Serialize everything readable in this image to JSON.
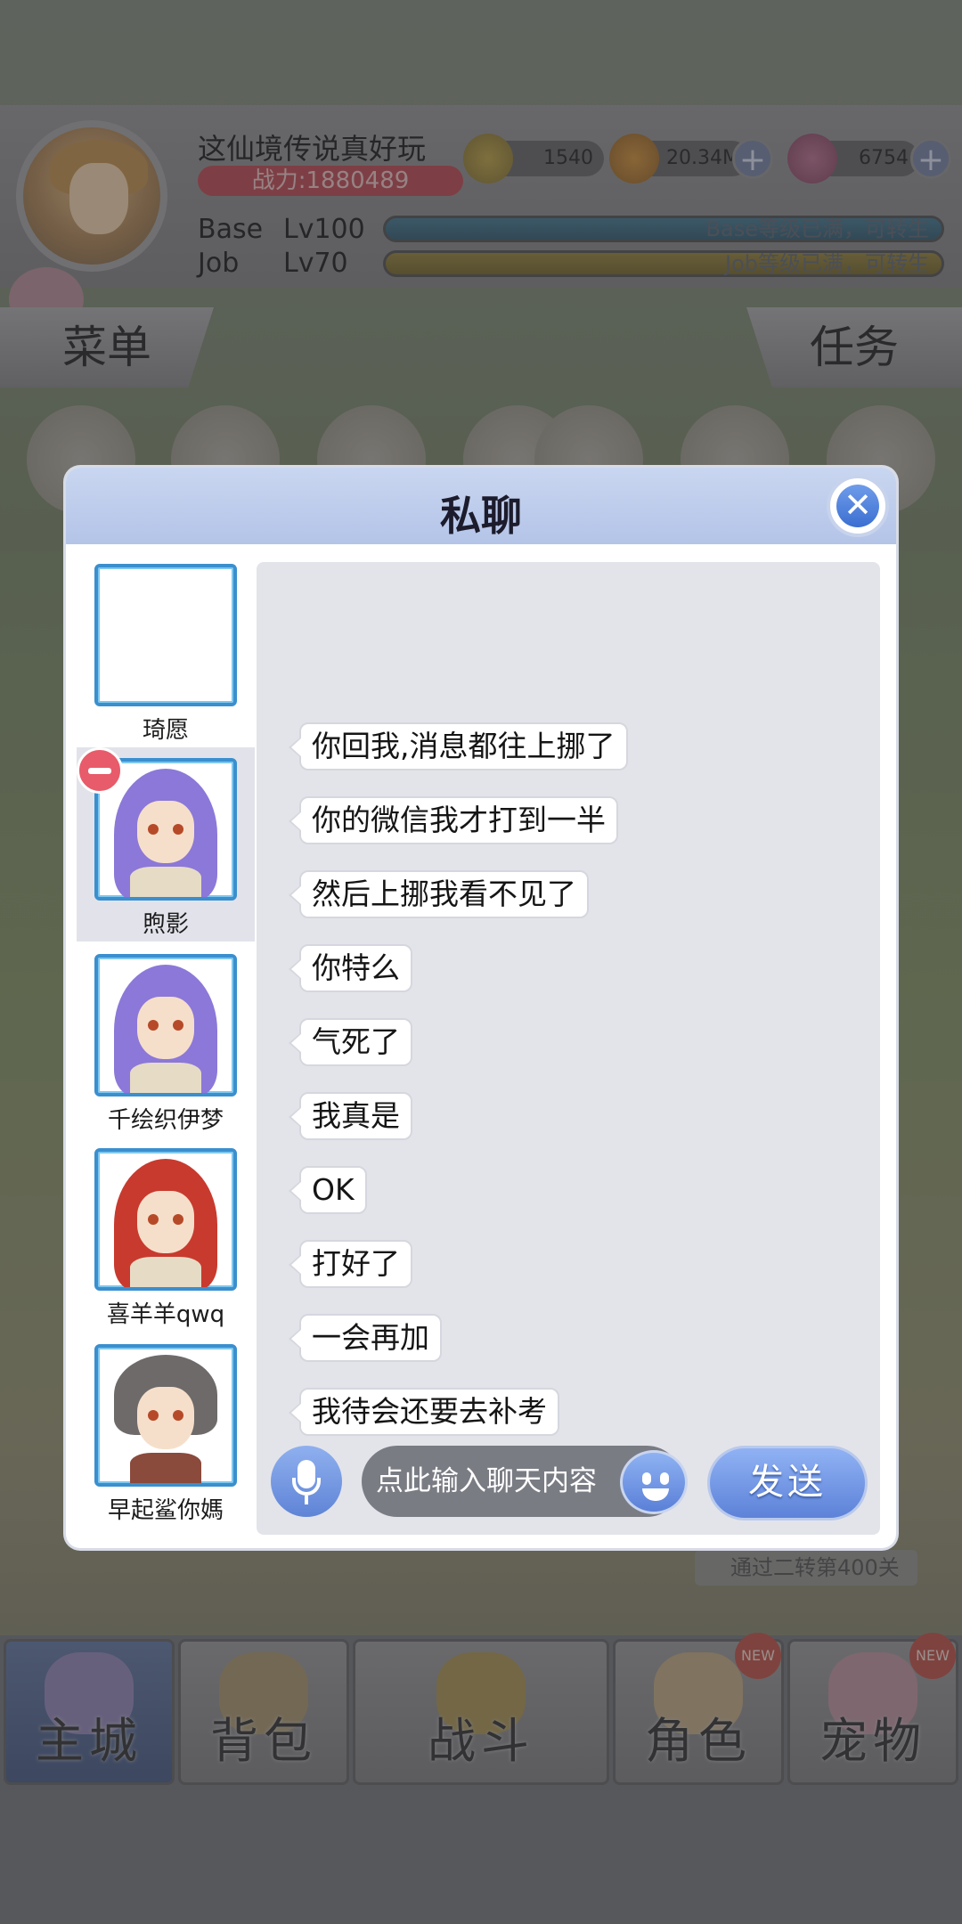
{
  "header": {
    "player_name": "这仙境传说真好玩",
    "power": "战力:1880489",
    "resources": [
      {
        "icon": "gold-z-coin-icon",
        "value": "1540"
      },
      {
        "icon": "cookie-coin-icon",
        "value": "20.34M"
      },
      {
        "icon": "gem-icon",
        "value": "6754"
      }
    ],
    "base_label": "Base",
    "base_level": "Lv100",
    "base_bar_text": "Base等级已满，可转生",
    "job_label": "Job",
    "job_level": "Lv70",
    "job_bar_text": "Job等级已满，可转生"
  },
  "tabs": {
    "menu": "菜单",
    "task": "任务"
  },
  "modal": {
    "title": "私聊",
    "friends": [
      {
        "name": "琦愿",
        "avatar": "empty"
      },
      {
        "name": "煦影",
        "avatar": "purple-hair",
        "selected": true
      },
      {
        "name": "千绘织伊梦",
        "avatar": "purple-hair"
      },
      {
        "name": "喜羊羊qwq",
        "avatar": "red-hair"
      },
      {
        "name": "早起鲨你媽",
        "avatar": "grey-hair"
      }
    ],
    "messages": [
      "你回我,消息都往上挪了",
      "你的微信我才打到一半",
      "然后上挪我看不见了",
      "你特么",
      "气死了",
      "我真是",
      "OK",
      "打好了",
      "一会再加",
      "我待会还要去补考"
    ],
    "input_placeholder": "点此输入聊天内容",
    "send_label": "发送"
  },
  "bottom_nav": [
    {
      "label": "主城",
      "active": true
    },
    {
      "label": "背包"
    },
    {
      "label": "战斗"
    },
    {
      "label": "角色",
      "badge": "NEW"
    },
    {
      "label": "宠物",
      "badge": "NEW"
    }
  ],
  "bg_hint": "通过二转第400关",
  "colors": {
    "modal_header": "#b4c4e8",
    "accent_blue": "#5d82d8",
    "chat_bg": "#e3e4ea",
    "delete_red": "#e85b6a"
  }
}
